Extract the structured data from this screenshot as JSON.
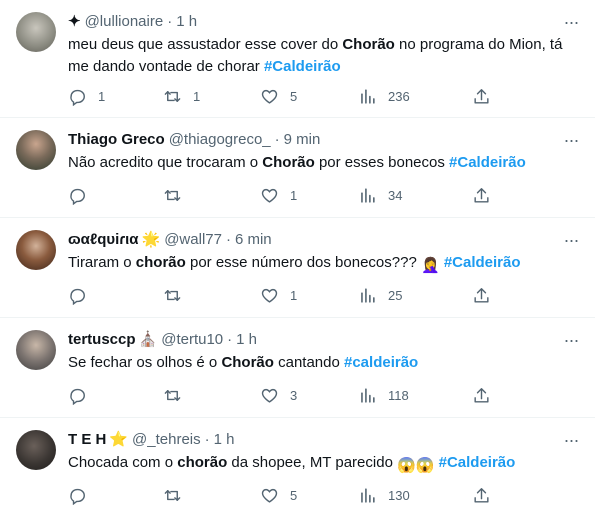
{
  "tweets": [
    {
      "name": "",
      "badge": "✦",
      "handle": "@lullionaire",
      "time": "1 h",
      "text_parts": [
        "meu deus que assustador esse cover do ",
        "Chorão",
        " no programa do Mion, tá me dando vontade de chorar ",
        "#Caldeirão"
      ],
      "replies": "1",
      "retweets": "1",
      "likes": "5",
      "views": "236",
      "avatar_color": "#8a8a80"
    },
    {
      "name": "Thiago Greco",
      "handle": "@thiagogreco_",
      "time": "9 min",
      "text_parts": [
        "Não acredito que trocaram o ",
        "Chorão",
        " por esses bonecos ",
        "#Caldeirão"
      ],
      "replies": "",
      "retweets": "",
      "likes": "1",
      "views": "34",
      "avatar_color": "#3a4a3a"
    },
    {
      "name": "ɷαℓqυiɾια",
      "name_emoji": "🌟",
      "handle": "@wall77",
      "time": "6 min",
      "text_parts": [
        "Tiraram o ",
        "chorão",
        " por esse número dos bonecos??? ",
        "🤦‍♀️",
        " ",
        "#Caldeirão"
      ],
      "replies": "",
      "retweets": "",
      "likes": "1",
      "views": "25",
      "avatar_color": "#5a3b2a"
    },
    {
      "name": "tertusccp",
      "name_emoji": "⛪",
      "handle": "@tertu10",
      "time": "1 h",
      "text_parts": [
        "Se fechar os olhos é o ",
        "Chorão",
        " cantando ",
        "#caldeirão"
      ],
      "replies": "",
      "retweets": "",
      "likes": "3",
      "views": "118",
      "avatar_color": "#6b6b6b"
    },
    {
      "name": "T E H",
      "name_emoji": "⭐",
      "handle": "@_tehreis",
      "time": "1 h",
      "text_parts": [
        "Chocada com o ",
        "chorão",
        " da shopee, MT parecido ",
        "😱😱",
        " ",
        "#Caldeirão"
      ],
      "replies": "",
      "retweets": "",
      "likes": "5",
      "views": "130",
      "avatar_color": "#2e2a28"
    }
  ],
  "icons": {
    "reply": "reply-icon",
    "retweet": "retweet-icon",
    "like": "heart-icon",
    "views": "views-icon",
    "share": "share-icon",
    "more": "more-icon"
  },
  "colors": {
    "hashtag": "#1d9bf0",
    "muted": "#536471",
    "text": "#0f1419",
    "divider": "#eff3f4"
  }
}
